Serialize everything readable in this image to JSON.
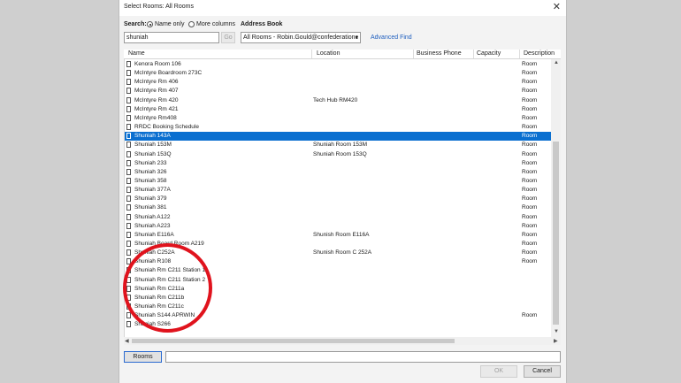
{
  "window": {
    "title": "Select Rooms: All Rooms"
  },
  "search": {
    "label": "Search:",
    "name_only_label": "Name only",
    "more_columns_label": "More columns",
    "query": "shuniah",
    "go_label": "Go"
  },
  "address_book": {
    "label": "Address Book",
    "selected": "All Rooms - Robin.Gould@confederationc",
    "advanced_find_label": "Advanced Find"
  },
  "columns": [
    "Name",
    "Location",
    "Business Phone",
    "Capacity",
    "Description"
  ],
  "rows": [
    {
      "name": "Kenora Room 106",
      "location": "",
      "description": "Room"
    },
    {
      "name": "McIntyre Boardroom 273C",
      "location": "",
      "description": "Room"
    },
    {
      "name": "McIntyre Rm 406",
      "location": "",
      "description": "Room"
    },
    {
      "name": "McIntyre Rm 407",
      "location": "",
      "description": "Room"
    },
    {
      "name": "McIntyre Rm 420",
      "location": "Tech Hub RM420",
      "description": "Room"
    },
    {
      "name": "McIntyre Rm 421",
      "location": "",
      "description": "Room"
    },
    {
      "name": "McIntyre Rm408",
      "location": "",
      "description": "Room"
    },
    {
      "name": "RRDC Booking Schedule",
      "location": "",
      "description": "Room"
    },
    {
      "name": "Shuniah 143A",
      "location": "",
      "description": "Room",
      "selected": true
    },
    {
      "name": "Shuniah 153M",
      "location": "Shuniah Room 153M",
      "description": "Room"
    },
    {
      "name": "Shuniah 153Q",
      "location": "Shuniah Room 153Q",
      "description": "Room"
    },
    {
      "name": "Shuniah 233",
      "location": "",
      "description": "Room"
    },
    {
      "name": "Shuniah 326",
      "location": "",
      "description": "Room"
    },
    {
      "name": "Shuniah 358",
      "location": "",
      "description": "Room"
    },
    {
      "name": "Shuniah 377A",
      "location": "",
      "description": "Room"
    },
    {
      "name": "Shuniah 379",
      "location": "",
      "description": "Room"
    },
    {
      "name": "Shuniah 381",
      "location": "",
      "description": "Room"
    },
    {
      "name": "Shuniah A122",
      "location": "",
      "description": "Room"
    },
    {
      "name": "Shuniah A223",
      "location": "",
      "description": "Room"
    },
    {
      "name": "Shuniah E116A",
      "location": "Shunish Room E116A",
      "description": "Room"
    },
    {
      "name": "Shuniah Board Room A219",
      "location": "",
      "description": "Room"
    },
    {
      "name": "Shuniah C252A",
      "location": "Shunish Room C 252A",
      "description": "Room"
    },
    {
      "name": "Shuniah R108",
      "location": "",
      "description": "Room"
    },
    {
      "name": "Shuniah Rm C211 Station 1",
      "location": "",
      "description": ""
    },
    {
      "name": "Shuniah Rm C211 Station 2",
      "location": "",
      "description": ""
    },
    {
      "name": "Shuniah Rm C211a",
      "location": "",
      "description": ""
    },
    {
      "name": "Shuniah Rm C211b",
      "location": "",
      "description": ""
    },
    {
      "name": "Shuniah Rm C211c",
      "location": "",
      "description": ""
    },
    {
      "name": "Shuniah S144 APRWIN",
      "location": "",
      "description": "Room"
    },
    {
      "name": "Shuniah S266",
      "location": "",
      "description": ""
    }
  ],
  "footer": {
    "rooms_button": "Rooms",
    "rooms_value": "",
    "ok_label": "OK",
    "cancel_label": "Cancel"
  },
  "colors": {
    "selection": "#0a6fd0",
    "annotation_circle": "#e0131d",
    "link": "#1f5fbf"
  }
}
